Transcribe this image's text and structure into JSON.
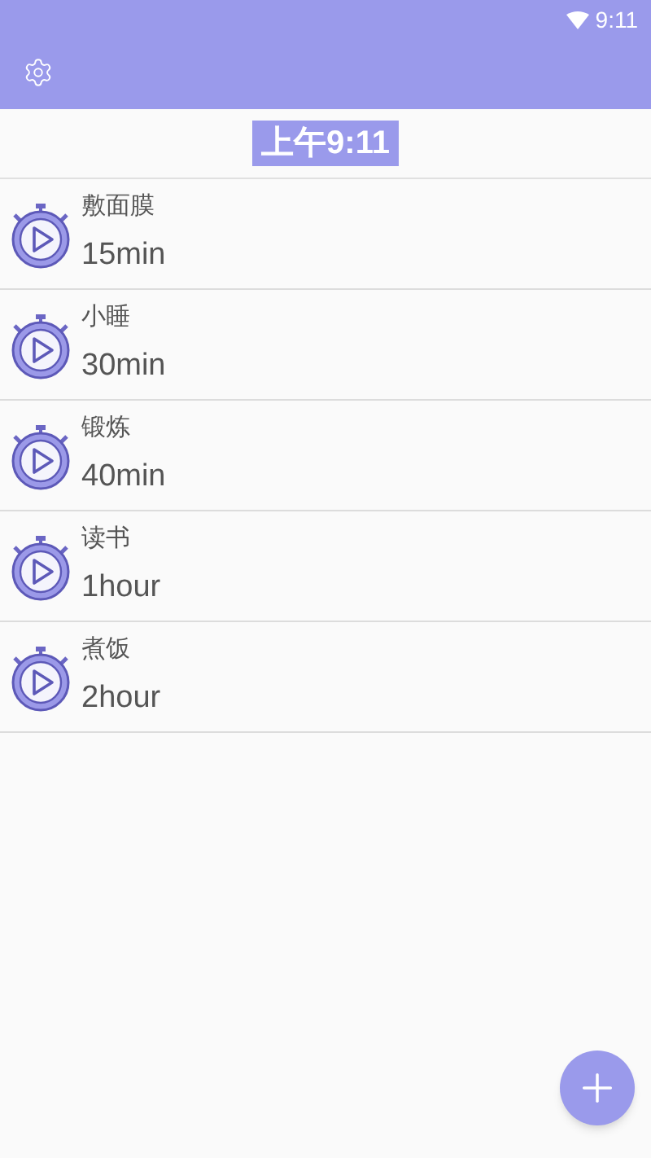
{
  "status_bar": {
    "time": "9:11"
  },
  "clock": "上午9:11",
  "timers": [
    {
      "name": "敷面膜",
      "duration": "15min"
    },
    {
      "name": "小睡",
      "duration": "30min"
    },
    {
      "name": "锻炼",
      "duration": "40min"
    },
    {
      "name": "读书",
      "duration": "1hour"
    },
    {
      "name": "煮饭",
      "duration": "2hour"
    }
  ]
}
